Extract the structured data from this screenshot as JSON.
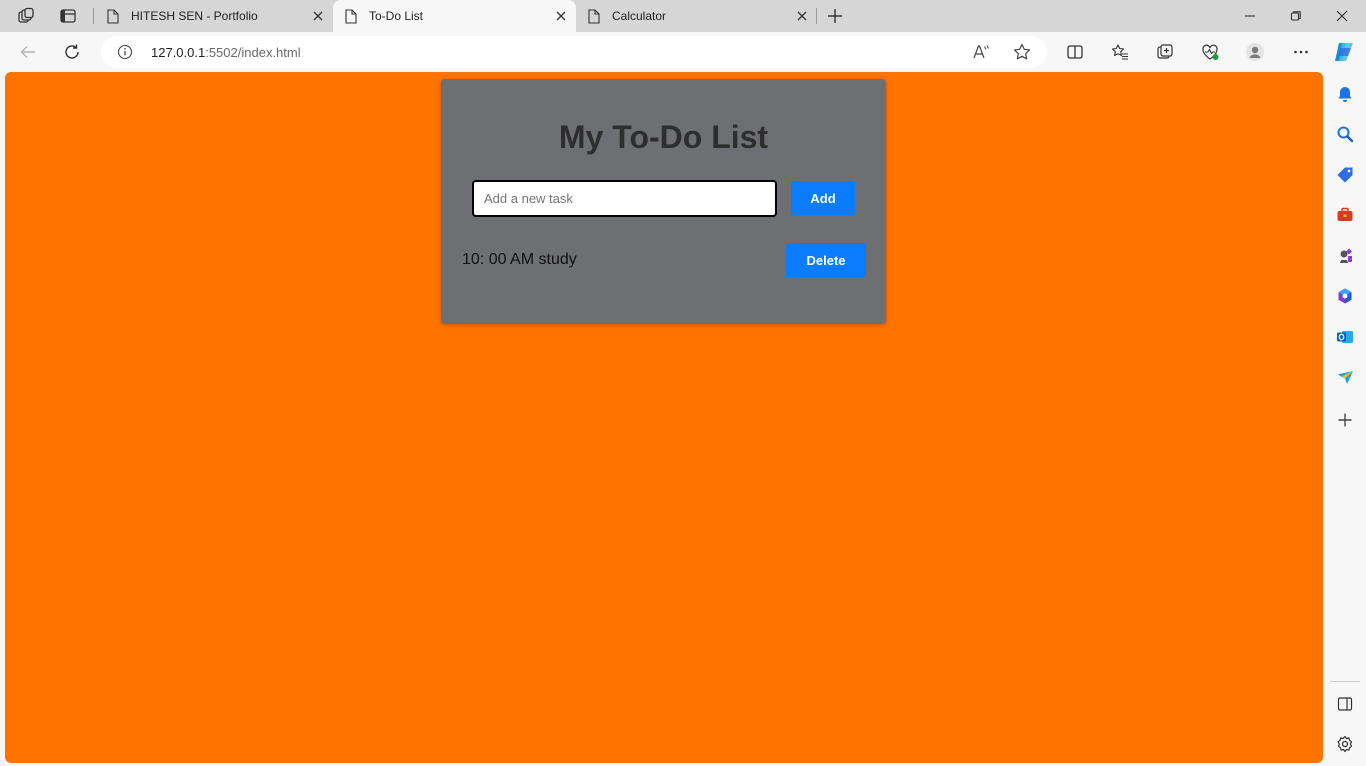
{
  "tabs": [
    {
      "title": "HITESH SEN - Portfolio",
      "active": false
    },
    {
      "title": "To-Do List",
      "active": true
    },
    {
      "title": "Calculator",
      "active": false
    }
  ],
  "address_bar": {
    "host": "127.0.0.1",
    "path": ":5502/index.html"
  },
  "app": {
    "title": "My To-Do List",
    "input_placeholder": "Add a new task",
    "input_value": "",
    "add_label": "Add",
    "tasks": [
      {
        "text": "10: 00 AM study",
        "delete_label": "Delete"
      }
    ]
  },
  "colors": {
    "page_background": "#ff7300",
    "card_background": "#6e6f73",
    "button_blue": "#0a7cff"
  },
  "icons": {
    "tabstrip": [
      "workspaces-icon",
      "tab-actions-icon"
    ],
    "toolbar": [
      "back-icon",
      "refresh-icon",
      "site-info-icon",
      "read-aloud-icon",
      "favorite-star-icon",
      "split-screen-icon",
      "favorites-icon",
      "collections-icon",
      "browser-essentials-icon",
      "profile-icon",
      "more-menu-icon",
      "copilot-icon"
    ],
    "sidebar": [
      "notifications-icon",
      "search-icon",
      "shopping-icon",
      "tools-icon",
      "games-icon",
      "microsoft365-icon",
      "outlook-icon",
      "send-icon",
      "add-icon",
      "hide-sidebar-icon",
      "settings-icon"
    ]
  }
}
